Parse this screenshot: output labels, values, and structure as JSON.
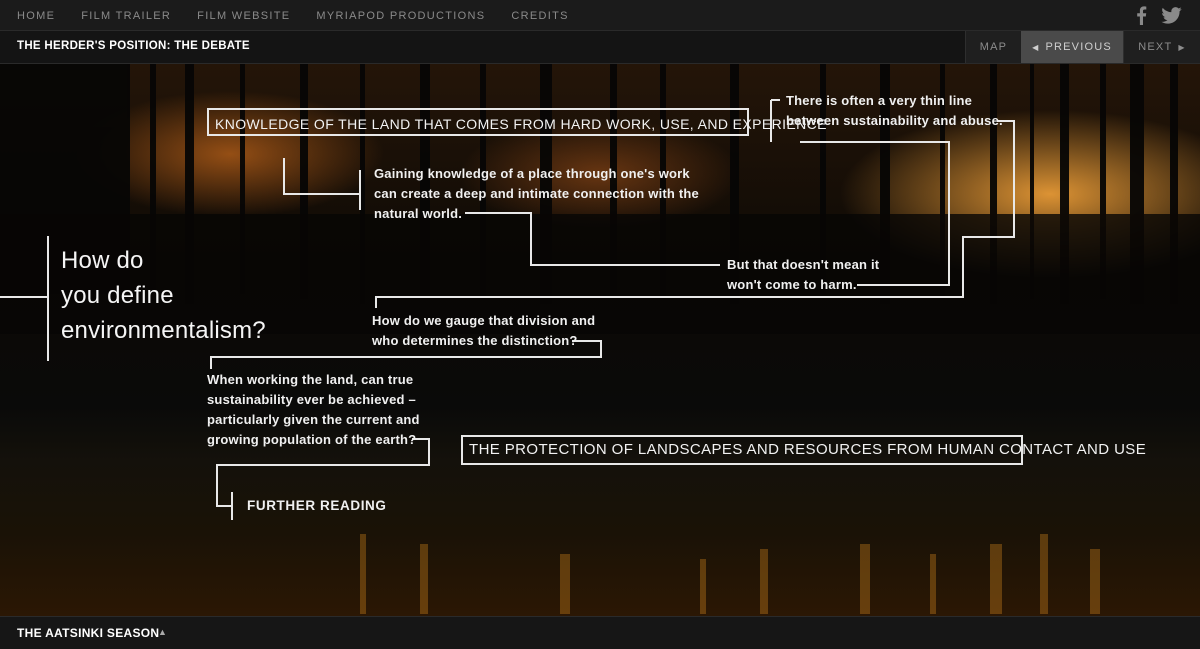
{
  "nav": {
    "items": [
      "HOME",
      "FILM TRAILER",
      "FILM WEBSITE",
      "MYRIAPOD PRODUCTIONS",
      "CREDITS"
    ],
    "social": [
      "facebook-icon",
      "twitter-icon"
    ]
  },
  "section": {
    "title": "THE HERDER'S POSITION: THE DEBATE",
    "map_label": "MAP",
    "prev_label": "PREVIOUS",
    "next_label": "NEXT"
  },
  "diagram": {
    "question": [
      "How do",
      "you define",
      "environmentalism?"
    ],
    "box_top": "KNOWLEDGE OF THE LAND THAT COMES FROM HARD WORK, USE, AND EXPERIENCE",
    "box_bottom": "THE PROTECTION OF LANDSCAPES AND RESOURCES FROM HUMAN CONTACT AND USE",
    "note_line": [
      "There is often a very thin line",
      "between sustainability and abuse."
    ],
    "note_knowledge": [
      "Gaining knowledge of a place through one's work",
      "can create a deep and intimate connection with the",
      "natural world."
    ],
    "note_harm": [
      "But that doesn't mean it",
      "won't come to harm."
    ],
    "note_gauge": [
      "How do we gauge that division and",
      "who determines the distinction?"
    ],
    "note_sustain": [
      "When working the land, can true",
      "sustainability ever be achieved –",
      "particularly given the current and",
      "growing population of the earth?"
    ],
    "further_reading": "FURTHER READING"
  },
  "footer": {
    "title": "THE AATSINKI SEASON"
  },
  "colors": {
    "line": "#e8e8e8",
    "nav_text": "#8a8a8a",
    "active_button": "#4a4a4a"
  }
}
